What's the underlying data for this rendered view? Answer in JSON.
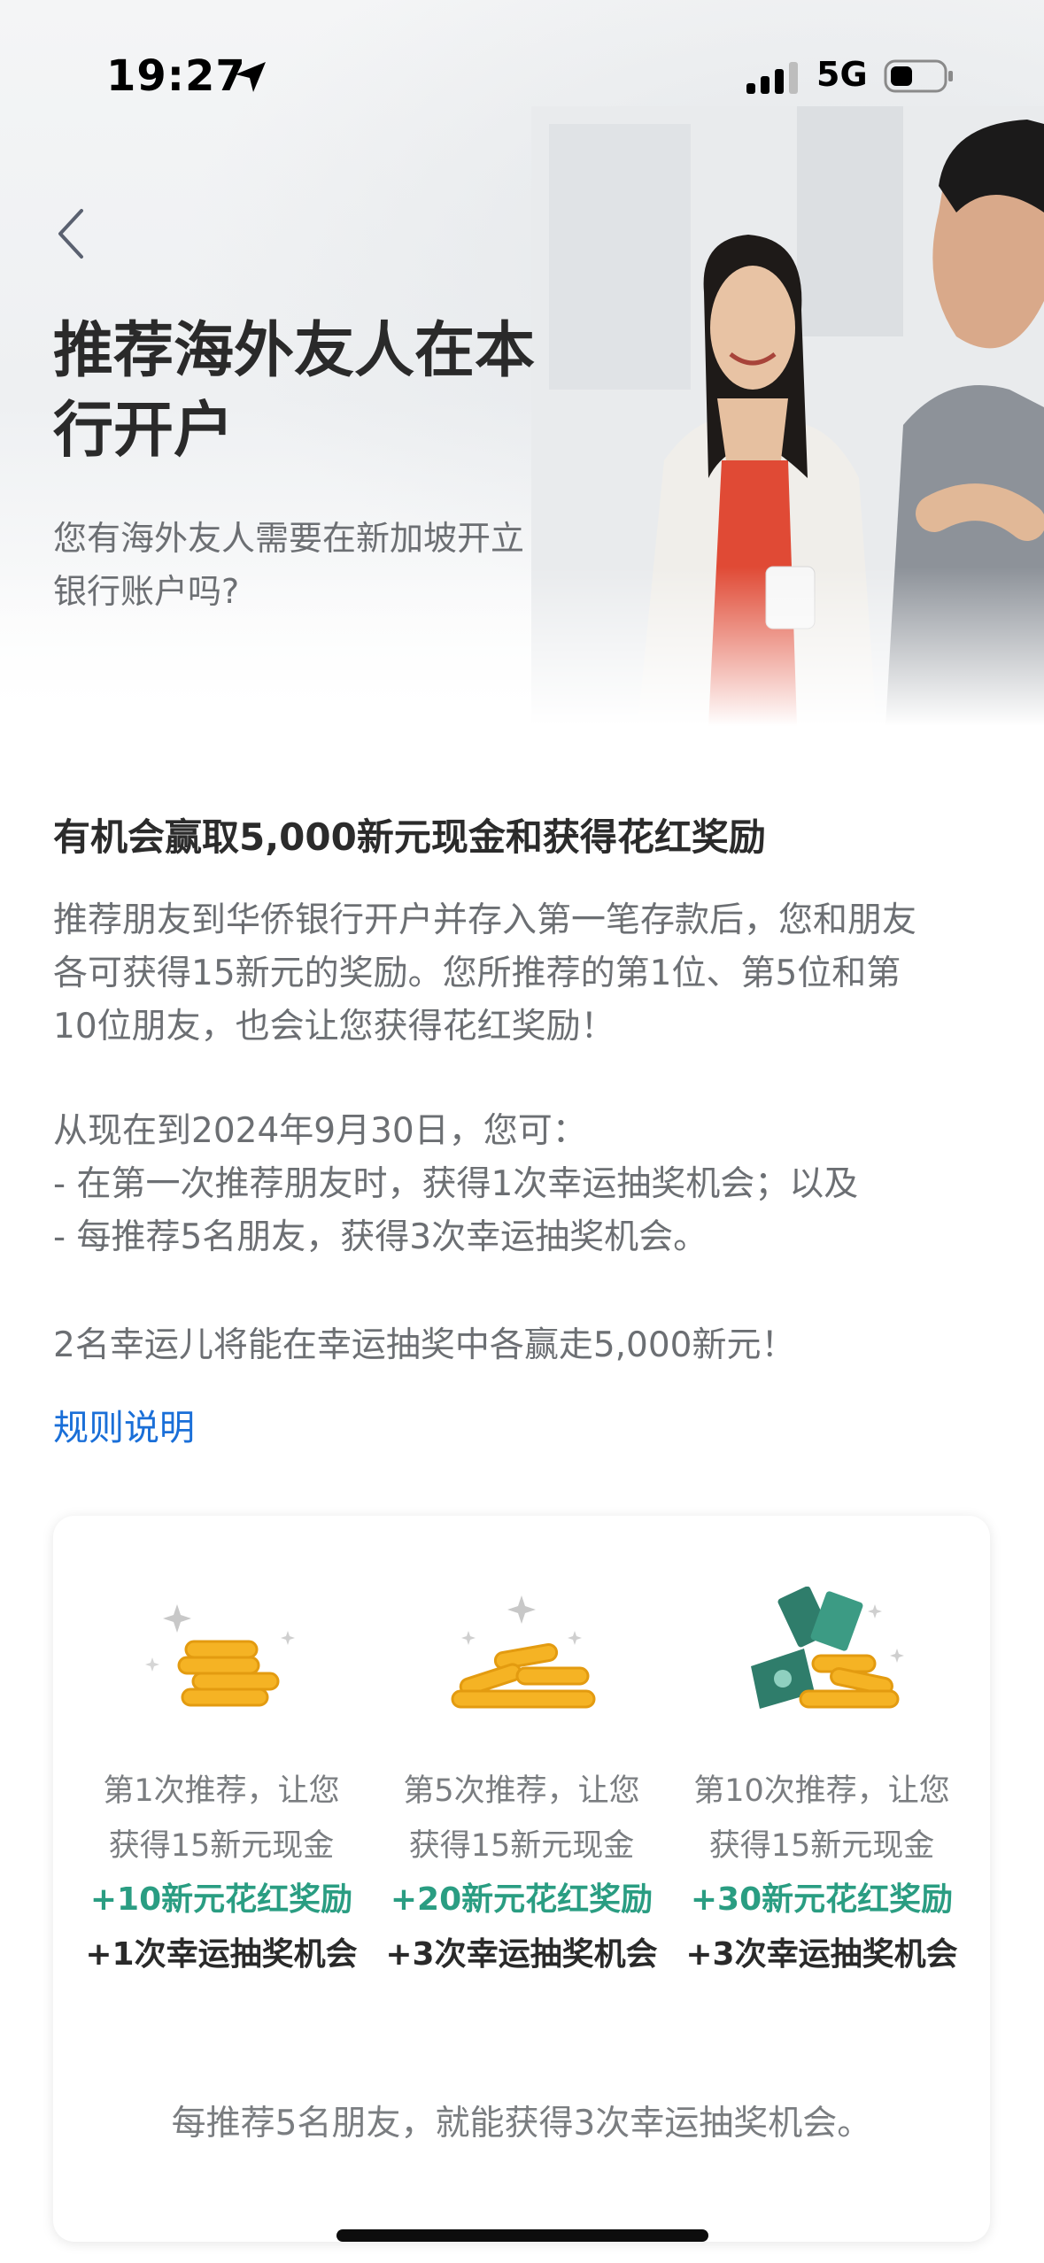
{
  "status_bar": {
    "time": "19:27",
    "network": "5G"
  },
  "hero": {
    "title_line1": "推荐海外友人在本",
    "title_line2": "行开户",
    "subtitle_line1": "您有海外友人需要在新加坡开立",
    "subtitle_line2": "银行账户吗?"
  },
  "promo": {
    "heading": "有机会赢取5,000新元现金和获得花红奖励",
    "para1": [
      "推荐朋友到华侨银行开户并存入第一笔存款后，您和朋友",
      "各可获得15新元的奖励。您所推荐的第1位、第5位和第",
      "10位朋友，也会让您获得花红奖励！"
    ],
    "para2": [
      "从现在到2024年9月30日，您可：",
      " - 在第一次推荐朋友时，获得1次幸运抽奖机会；以及",
      " - 每推荐5名朋友，获得3次幸运抽奖机会。"
    ],
    "para3": "2名幸运儿将能在幸运抽奖中各赢走5,000新元！",
    "rules_link": "规则说明"
  },
  "rewards": {
    "tiers": [
      {
        "line1": "第1次推荐，让您",
        "line2": "获得15新元现金",
        "bonus": "+10新元花红奖励",
        "draw": "+1次幸运抽奖机会",
        "icon": "coin-stack-icon"
      },
      {
        "line1": "第5次推荐，让您",
        "line2": "获得15新元现金",
        "bonus": "+20新元花红奖励",
        "draw": "+3次幸运抽奖机会",
        "icon": "coin-pile-icon"
      },
      {
        "line1": "第10次推荐，让您",
        "line2": "获得15新元现金",
        "bonus": "+30新元花红奖励",
        "draw": "+3次幸运抽奖机会",
        "icon": "cash-and-coins-icon"
      }
    ],
    "footer": "每推荐5名朋友，就能获得3次幸运抽奖机会。"
  },
  "colors": {
    "link": "#1a6fd8",
    "bonus_green": "#2a9d82",
    "coin_gold": "#f5b324"
  }
}
